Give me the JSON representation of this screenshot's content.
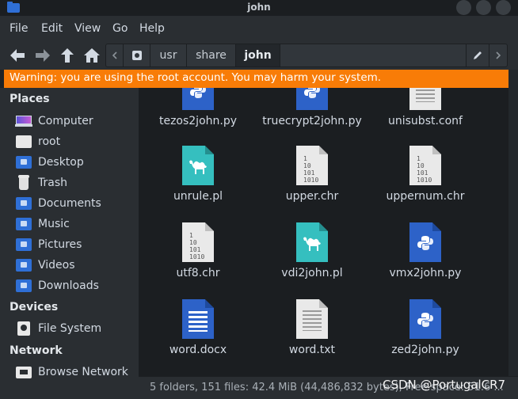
{
  "window": {
    "title": "john"
  },
  "menu": [
    "File",
    "Edit",
    "View",
    "Go",
    "Help"
  ],
  "path": {
    "segments": [
      "usr",
      "share",
      "john"
    ],
    "current_index": 2
  },
  "warning": "Warning: you are using the root account. You may harm your system.",
  "sidebar": {
    "places_header": "Places",
    "places": [
      {
        "label": "Computer",
        "icon": "computer-icon"
      },
      {
        "label": "root",
        "icon": "home-folder-icon"
      },
      {
        "label": "Desktop",
        "icon": "desktop-folder-icon"
      },
      {
        "label": "Trash",
        "icon": "trash-icon"
      },
      {
        "label": "Documents",
        "icon": "documents-folder-icon"
      },
      {
        "label": "Music",
        "icon": "music-folder-icon"
      },
      {
        "label": "Pictures",
        "icon": "pictures-folder-icon"
      },
      {
        "label": "Videos",
        "icon": "videos-folder-icon"
      },
      {
        "label": "Downloads",
        "icon": "downloads-folder-icon"
      }
    ],
    "devices_header": "Devices",
    "devices": [
      {
        "label": "File System",
        "icon": "drive-icon"
      }
    ],
    "network_header": "Network",
    "network": [
      {
        "label": "Browse Network",
        "icon": "network-icon"
      }
    ]
  },
  "files": [
    {
      "name": "tezos2john.py",
      "type": "python"
    },
    {
      "name": "truecrypt2john.py",
      "type": "python"
    },
    {
      "name": "unisubst.conf",
      "type": "text"
    },
    {
      "name": "unrule.pl",
      "type": "perl"
    },
    {
      "name": "upper.chr",
      "type": "binary"
    },
    {
      "name": "uppernum.chr",
      "type": "binary"
    },
    {
      "name": "utf8.chr",
      "type": "binary"
    },
    {
      "name": "vdi2john.pl",
      "type": "perl"
    },
    {
      "name": "vmx2john.py",
      "type": "python"
    },
    {
      "name": "word.docx",
      "type": "docx"
    },
    {
      "name": "word.txt",
      "type": "text"
    },
    {
      "name": "zed2john.py",
      "type": "python"
    }
  ],
  "binary_icon_text": [
    "1",
    "10",
    "101",
    "1010"
  ],
  "status": "5 folders, 151 files: 42.4 MiB (44,486,832 bytes), Free space: 51.6 ...",
  "watermark": "CSDN @PortugalCR7",
  "colors": {
    "warning": "#f87c07",
    "folder": "#2f6fd6",
    "python": "#2d62c8",
    "perl": "#35bfbf"
  }
}
